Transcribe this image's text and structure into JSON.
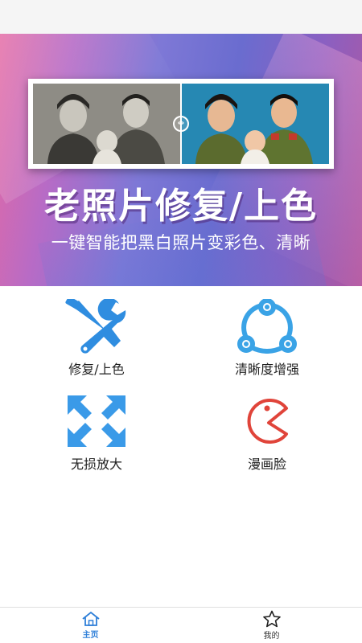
{
  "banner": {
    "title": "老照片修复/上色",
    "subtitle": "一键智能把黑白照片变彩色、清晰"
  },
  "features": [
    {
      "label": "修复/上色",
      "icon": "repair-tools-icon",
      "color": "#2f8de0"
    },
    {
      "label": "清晰度增强",
      "icon": "share-nodes-icon",
      "color": "#3aa3e6"
    },
    {
      "label": "无损放大",
      "icon": "expand-arrows-icon",
      "color": "#3a9ae8"
    },
    {
      "label": "漫画脸",
      "icon": "pacman-face-icon",
      "color": "#e0443a"
    }
  ],
  "tabbar": {
    "tabs": [
      {
        "label": "主页",
        "icon": "home-icon",
        "active": true
      },
      {
        "label": "我的",
        "icon": "star-icon",
        "active": false
      }
    ],
    "active_color": "#2f7fd8"
  }
}
